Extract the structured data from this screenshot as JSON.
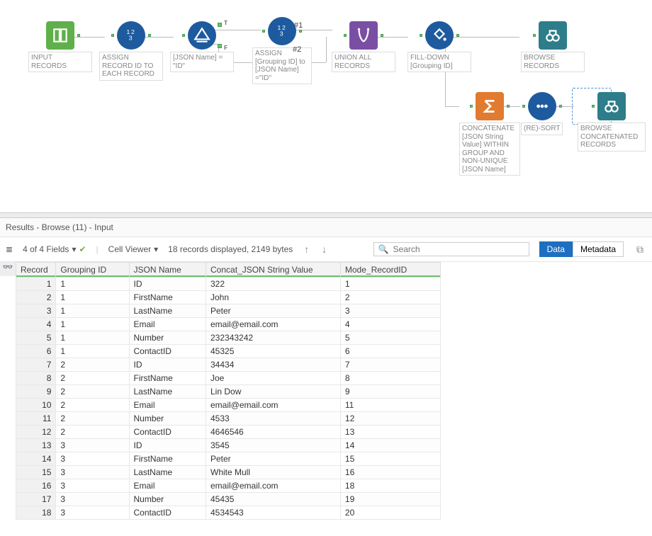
{
  "canvas": {
    "tools": {
      "input_records": {
        "label": "INPUT RECORDS",
        "icon": "book-icon"
      },
      "assign_record_id": {
        "label": "ASSIGN RECORD ID TO EACH RECORD",
        "icon": "numbers-icon"
      },
      "filter_json_name": {
        "label": "[JSON Name] = \"ID\"",
        "icon": "filter-icon",
        "tlabel": "T",
        "flabel": "F"
      },
      "assign_grouping": {
        "label": "ASSIGN [Grouping ID] to [JSON Name] =\"ID\"",
        "icon": "numbers-icon"
      },
      "union_all": {
        "label": "UNION ALL RECORDS",
        "icon": "union-icon"
      },
      "fill_down": {
        "label": "FILL-DOWN [Grouping ID]",
        "icon": "bucket-icon"
      },
      "browse1": {
        "label": "BROWSE RECORDS",
        "icon": "binoculars-icon"
      },
      "concatenate": {
        "label": "CONCATENATE [JSON String Value] WITHIN GROUP AND NON-UNIQUE [JSON Name]",
        "icon": "sigma-icon"
      },
      "resort": {
        "label": "(RE)-SORT",
        "icon": "dots-icon"
      },
      "browse2": {
        "label": "BROWSE CONCATENATED RECORDS",
        "icon": "binoculars-icon"
      }
    },
    "annotations": {
      "n1": "#1",
      "n2": "#2"
    }
  },
  "results": {
    "title": "Results - Browse (11) - Input",
    "field_selector": "4 of 4 Fields",
    "cell_viewer": "Cell Viewer",
    "records_info": "18 records displayed, 2149 bytes",
    "search_placeholder": "Search",
    "tabs": {
      "data": "Data",
      "metadata": "Metadata"
    },
    "columns": [
      "Record",
      "Grouping ID",
      "JSON Name",
      "Concat_JSON String Value",
      "Mode_RecordID"
    ],
    "rows": [
      {
        "r": 1,
        "g": "1",
        "n": "ID",
        "v": "322",
        "m": "1"
      },
      {
        "r": 2,
        "g": "1",
        "n": "FirstName",
        "v": "John",
        "m": "2"
      },
      {
        "r": 3,
        "g": "1",
        "n": "LastName",
        "v": "Peter",
        "m": "3"
      },
      {
        "r": 4,
        "g": "1",
        "n": "Email",
        "v": "email@email.com",
        "m": "4"
      },
      {
        "r": 5,
        "g": "1",
        "n": "Number",
        "v": "232343242",
        "m": "5"
      },
      {
        "r": 6,
        "g": "1",
        "n": "ContactID",
        "v": "45325",
        "m": "6"
      },
      {
        "r": 7,
        "g": "2",
        "n": "ID",
        "v": "34434",
        "m": "7"
      },
      {
        "r": 8,
        "g": "2",
        "n": "FirstName",
        "v": "Joe",
        "m": "8"
      },
      {
        "r": 9,
        "g": "2",
        "n": "LastName",
        "v": "Lin Dow",
        "m": "9"
      },
      {
        "r": 10,
        "g": "2",
        "n": "Email",
        "v": "email@email.com",
        "m": "11"
      },
      {
        "r": 11,
        "g": "2",
        "n": "Number",
        "v": "4533",
        "m": "12"
      },
      {
        "r": 12,
        "g": "2",
        "n": "ContactID",
        "v": "4646546",
        "m": "13"
      },
      {
        "r": 13,
        "g": "3",
        "n": "ID",
        "v": "3545",
        "m": "14"
      },
      {
        "r": 14,
        "g": "3",
        "n": "FirstName",
        "v": "Peter",
        "m": "15"
      },
      {
        "r": 15,
        "g": "3",
        "n": "LastName",
        "v": "White Mull",
        "m": "16"
      },
      {
        "r": 16,
        "g": "3",
        "n": "Email",
        "v": "email@email.com",
        "m": "18"
      },
      {
        "r": 17,
        "g": "3",
        "n": "Number",
        "v": "45435",
        "m": "19"
      },
      {
        "r": 18,
        "g": "3",
        "n": "ContactID",
        "v": "4534543",
        "m": "20"
      }
    ]
  }
}
